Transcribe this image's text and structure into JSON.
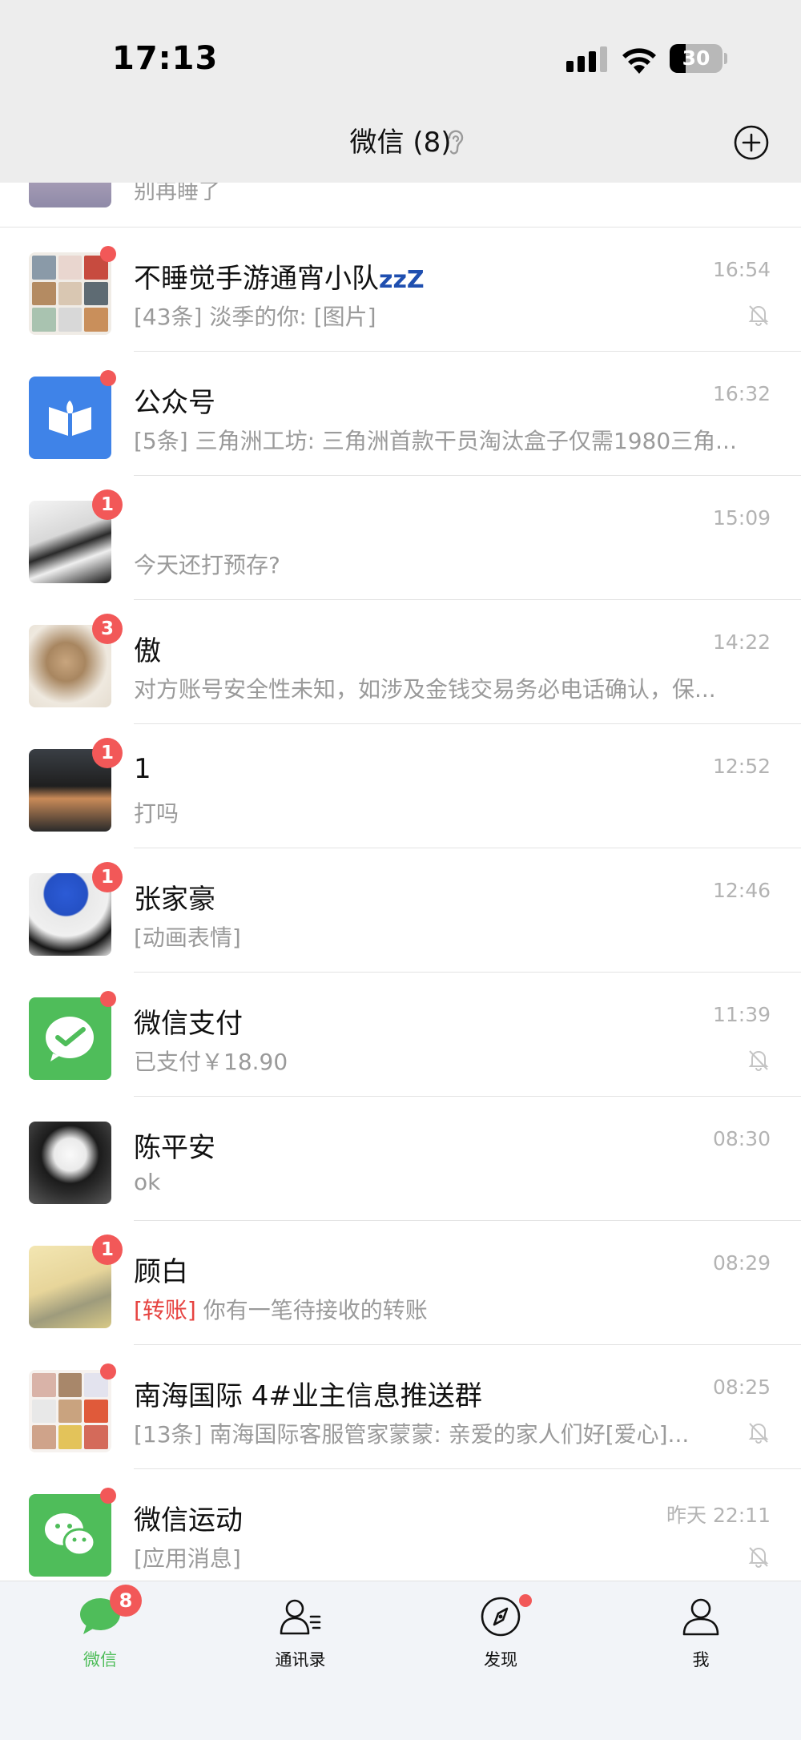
{
  "status_bar": {
    "time": "17:13",
    "battery": "30",
    "battery_level": 0.3
  },
  "nav": {
    "title": "微信 (8)"
  },
  "partial_chat": {
    "preview": "别再睡了"
  },
  "chats": [
    {
      "name": "不睡觉手游通宵小队",
      "name_suffix": "zzZ",
      "time": "16:54",
      "preview_tag": "",
      "preview": "[43条] 淡季的你: [图片]",
      "badge": "",
      "dot": true,
      "muted": true,
      "avatar_icon": "group-avatar"
    },
    {
      "name": "公众号",
      "name_suffix": "",
      "time": "16:32",
      "preview_tag": "",
      "preview": "[5条] 三角洲工坊: 三角洲首款干员淘汰盒子仅需1980三角...",
      "badge": "",
      "dot": true,
      "muted": false,
      "avatar_icon": "official-accounts-icon"
    },
    {
      "name": "",
      "name_suffix": "",
      "time": "15:09",
      "preview_tag": "",
      "preview": "今天还打预存?",
      "badge": "1",
      "dot": false,
      "muted": false,
      "avatar_icon": "avatar-image"
    },
    {
      "name": "傲",
      "name_suffix": "",
      "time": "14:22",
      "preview_tag": "",
      "preview": "对方账号安全性未知，如涉及金钱交易务必电话确认，保...",
      "badge": "3",
      "dot": false,
      "muted": false,
      "avatar_icon": "avatar-image"
    },
    {
      "name": "1",
      "name_suffix": "",
      "time": "12:52",
      "preview_tag": "",
      "preview": "打吗",
      "badge": "1",
      "dot": false,
      "muted": false,
      "avatar_icon": "avatar-image"
    },
    {
      "name": "张家豪",
      "name_suffix": "",
      "time": "12:46",
      "preview_tag": "",
      "preview": "[动画表情]",
      "badge": "1",
      "dot": false,
      "muted": false,
      "avatar_icon": "avatar-image"
    },
    {
      "name": "微信支付",
      "name_suffix": "",
      "time": "11:39",
      "preview_tag": "",
      "preview": "已支付￥18.90",
      "badge": "",
      "dot": true,
      "muted": true,
      "avatar_icon": "wechat-pay-icon"
    },
    {
      "name": "陈平安",
      "name_suffix": "",
      "time": "08:30",
      "preview_tag": "",
      "preview": "ok",
      "badge": "",
      "dot": false,
      "muted": false,
      "avatar_icon": "avatar-image"
    },
    {
      "name": "顾白",
      "name_suffix": "",
      "time": "08:29",
      "preview_tag": "[转账]",
      "preview": "你有一笔待接收的转账",
      "badge": "1",
      "dot": false,
      "muted": false,
      "avatar_icon": "avatar-image"
    },
    {
      "name": "南海国际 4#业主信息推送群",
      "name_suffix": "",
      "time": "08:25",
      "preview_tag": "",
      "preview": "[13条] 南海国际客服管家蒙蒙: 亲爱的家人们好[爱心]...",
      "badge": "",
      "dot": true,
      "muted": true,
      "avatar_icon": "group-avatar"
    },
    {
      "name": "微信运动",
      "name_suffix": "",
      "time": "昨天 22:11",
      "preview_tag": "",
      "preview": "[应用消息]",
      "badge": "",
      "dot": true,
      "muted": true,
      "avatar_icon": "wechat-sport-icon"
    }
  ],
  "tabs": [
    {
      "label": "微信",
      "icon": "chats-icon",
      "active": true,
      "badge": "8"
    },
    {
      "label": "通讯录",
      "icon": "contacts-icon",
      "active": false,
      "badge": ""
    },
    {
      "label": "发现",
      "icon": "discover-icon",
      "active": false,
      "badge": "",
      "dot": true
    },
    {
      "label": "我",
      "icon": "me-icon",
      "active": false,
      "badge": ""
    }
  ],
  "colors": {
    "accent": "#4fbd5a",
    "badge": "#f25858",
    "header_bg": "#ededed",
    "tabbar_bg": "#f2f4f8"
  }
}
